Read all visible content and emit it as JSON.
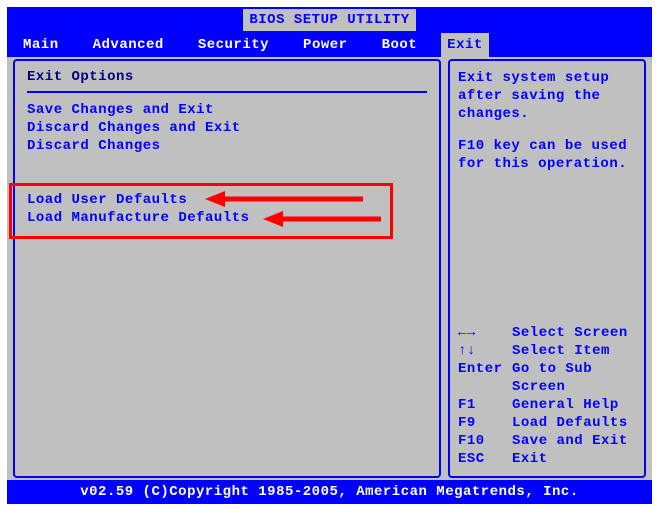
{
  "title": "BIOS SETUP UTILITY",
  "menu": {
    "items": [
      "Main",
      "Advanced",
      "Security",
      "Power",
      "Boot"
    ],
    "active": "Exit"
  },
  "left_panel": {
    "heading": "Exit Options",
    "group1": [
      "Save Changes and Exit",
      "Discard Changes and Exit",
      "Discard Changes"
    ],
    "group2": [
      "Load User Defaults",
      "Load Manufacture Defaults"
    ]
  },
  "right_panel": {
    "desc": "Exit system setup after saving the changes.",
    "hint": "F10 key can be used for this operation."
  },
  "help_keys": [
    {
      "k": "←→",
      "v": "Select Screen"
    },
    {
      "k": "↑↓",
      "v": "Select Item"
    },
    {
      "k": "Enter",
      "v": "Go to Sub Screen"
    },
    {
      "k": "F1",
      "v": "General Help"
    },
    {
      "k": "F9",
      "v": "Load Defaults"
    },
    {
      "k": "F10",
      "v": "Save and Exit"
    },
    {
      "k": "ESC",
      "v": "Exit"
    }
  ],
  "footer": "v02.59 (C)Copyright 1985-2005, American Megatrends, Inc."
}
